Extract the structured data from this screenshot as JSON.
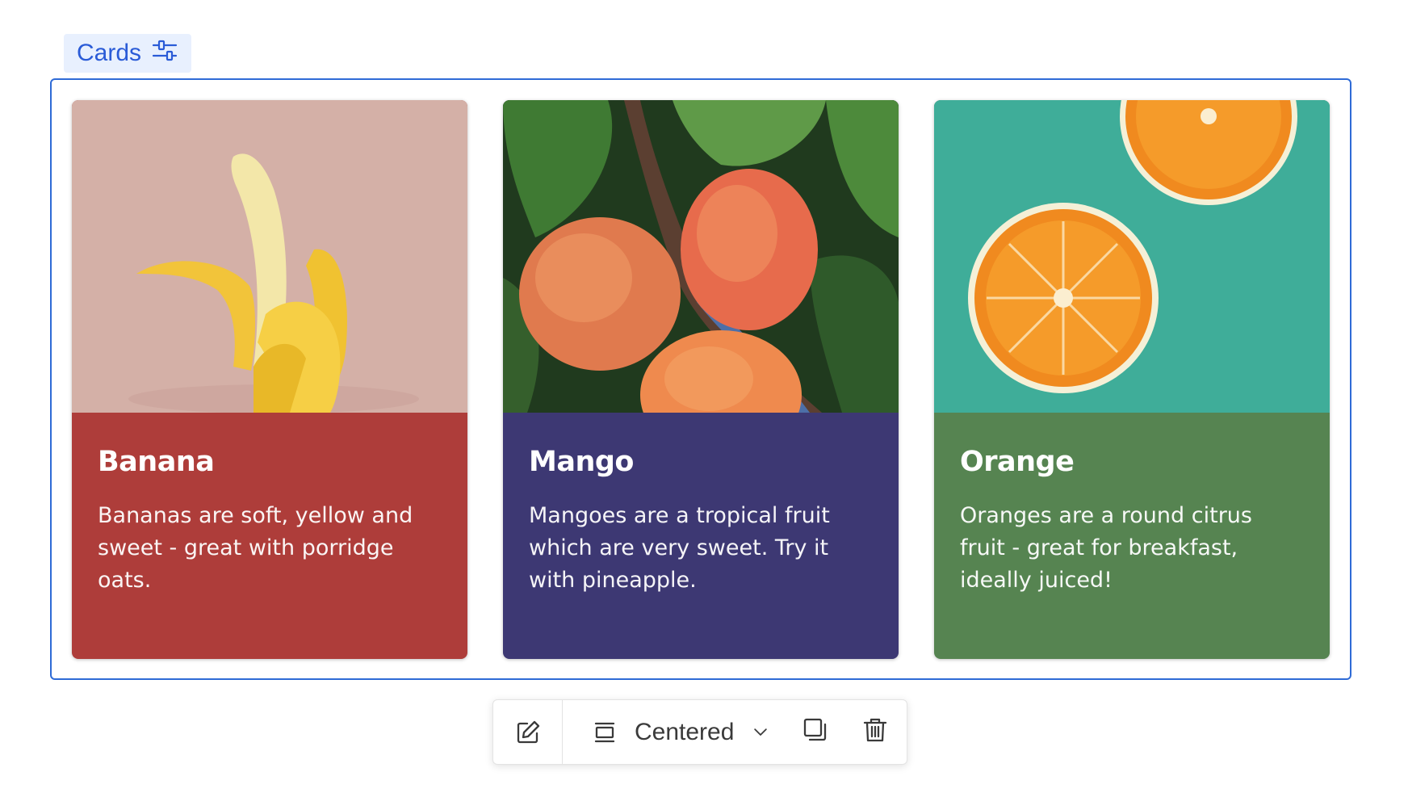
{
  "block_label": {
    "text": "Cards",
    "icon": "sliders-icon"
  },
  "colors": {
    "accent": "#2f6bd6",
    "label_bg": "#e8f0fe",
    "banana": "#ae3d3a",
    "mango": "#3d3873",
    "orange": "#568451"
  },
  "cards": [
    {
      "title": "Banana",
      "text": "Bananas are soft, yellow and sweet - great with porridge oats.",
      "color": "#ae3d3a",
      "image": "banana-photo"
    },
    {
      "title": "Mango",
      "text": "Mangoes are a tropical fruit which are very sweet. Try it with pineapple.",
      "color": "#3d3873",
      "image": "mango-photo"
    },
    {
      "title": "Orange",
      "text": "Oranges are a round citrus fruit - great for breakfast, ideally juiced!",
      "color": "#568451",
      "image": "orange-photo"
    }
  ],
  "toolbar": {
    "edit_icon": "edit-icon",
    "layout_icon": "layout-centered-icon",
    "layout_label": "Centered",
    "dropdown_icon": "chevron-down-icon",
    "duplicate_icon": "duplicate-icon",
    "delete_icon": "trash-icon"
  }
}
